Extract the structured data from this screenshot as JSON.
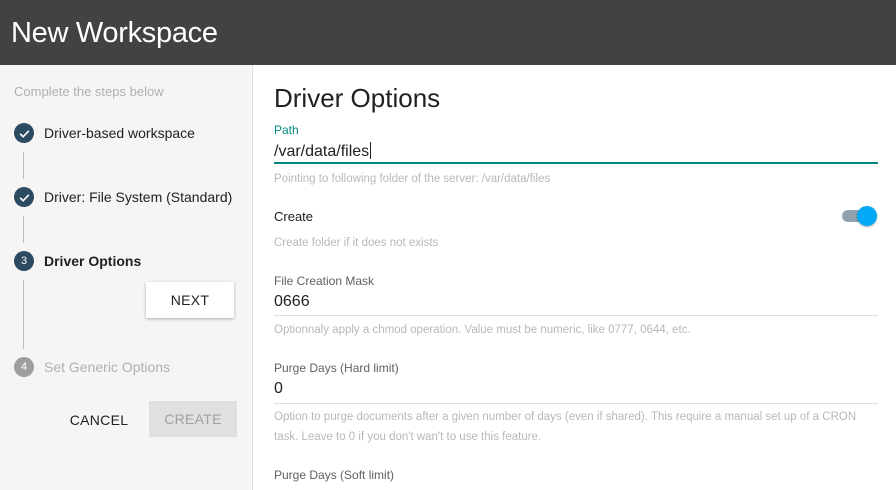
{
  "header": {
    "title": "New Workspace"
  },
  "sidebar": {
    "hint": "Complete the steps below",
    "steps": [
      {
        "label": "Driver-based workspace",
        "state": "done"
      },
      {
        "label": "Driver: File System (Standard)",
        "state": "done"
      },
      {
        "label": "Driver Options",
        "number": "3",
        "state": "active"
      },
      {
        "label": "Set Generic Options",
        "number": "4",
        "state": "pending"
      }
    ],
    "next_label": "Next",
    "cancel_label": "Cancel",
    "create_label": "Create"
  },
  "main": {
    "title": "Driver Options",
    "path": {
      "label": "Path",
      "value": "/var/data/files",
      "helper": "Pointing to following folder of the server: /var/data/files"
    },
    "create": {
      "label": "Create",
      "enabled": true,
      "helper": "Create folder if it does not exists"
    },
    "mask": {
      "label": "File Creation Mask",
      "value": "0666",
      "helper": "Optionnaly apply a chmod operation. Value must be numeric, like 0777, 0644, etc."
    },
    "purge_hard": {
      "label": "Purge Days (Hard limit)",
      "value": "0",
      "helper": "Option to purge documents after a given number of days (even if shared). This require a manual set up of a CRON task. Leave to 0 if you don't wan't to use this feature."
    },
    "purge_soft": {
      "label": "Purge Days (Soft limit)"
    }
  },
  "colors": {
    "header_bg": "#424242",
    "step_done": "#2c4a60",
    "focus_accent": "#00897b",
    "toggle_on": "#03a9f4"
  }
}
